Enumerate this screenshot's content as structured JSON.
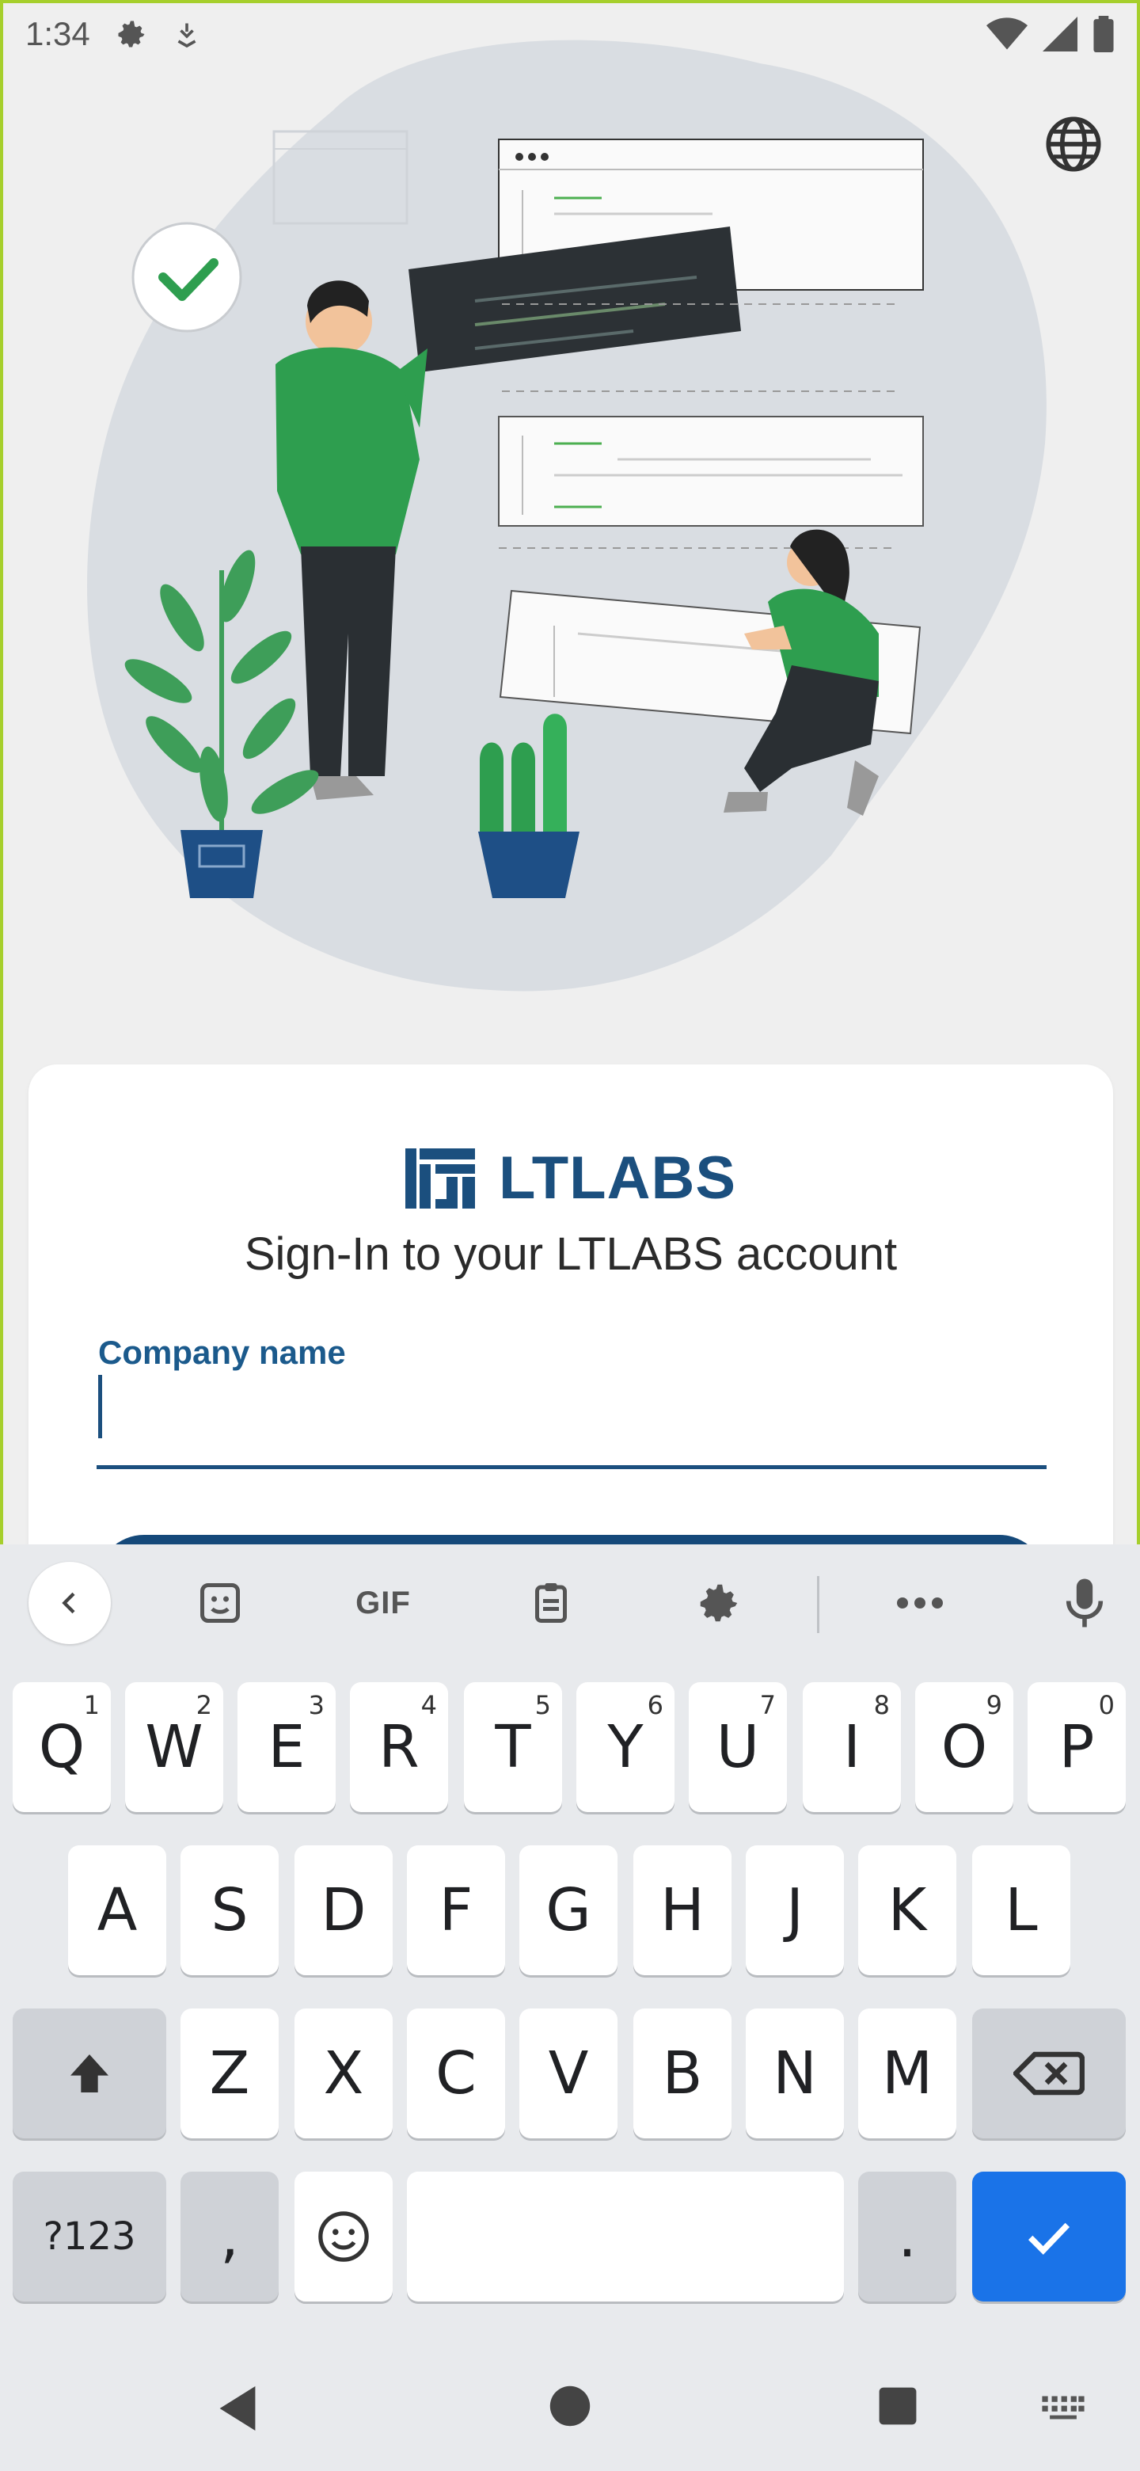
{
  "status_bar": {
    "time": "1:34",
    "icons": [
      "settings-icon",
      "download-icon",
      "wifi-icon",
      "signal-icon",
      "battery-icon"
    ]
  },
  "top_bar": {
    "language_icon": "globe-icon"
  },
  "login": {
    "brand": "LTLABS",
    "subtitle": "Sign-In to your LTLABS account",
    "company_field": {
      "label": "Company name",
      "value": ""
    }
  },
  "keyboard": {
    "toolbar": {
      "back_icon": "chevron-left-icon",
      "sticker_icon": "sticker-icon",
      "gif_label": "GIF",
      "clipboard_icon": "clipboard-icon",
      "settings_icon": "gear-icon",
      "more_icon": "more-icon",
      "mic_icon": "mic-icon"
    },
    "row1": [
      {
        "key": "Q",
        "hint": "1"
      },
      {
        "key": "W",
        "hint": "2"
      },
      {
        "key": "E",
        "hint": "3"
      },
      {
        "key": "R",
        "hint": "4"
      },
      {
        "key": "T",
        "hint": "5"
      },
      {
        "key": "Y",
        "hint": "6"
      },
      {
        "key": "U",
        "hint": "7"
      },
      {
        "key": "I",
        "hint": "8"
      },
      {
        "key": "O",
        "hint": "9"
      },
      {
        "key": "P",
        "hint": "0"
      }
    ],
    "row2": [
      "A",
      "S",
      "D",
      "F",
      "G",
      "H",
      "J",
      "K",
      "L"
    ],
    "row3": [
      "Z",
      "X",
      "C",
      "V",
      "B",
      "N",
      "M"
    ],
    "row4": {
      "symbols": "?123",
      "comma": ",",
      "period": "."
    },
    "colors": {
      "background": "#e8eaed",
      "action": "#1a73e8"
    }
  },
  "nav_bar": {
    "icons": [
      "back-icon",
      "home-icon",
      "recents-icon",
      "keyboard-switch-icon"
    ]
  },
  "colors": {
    "brand": "#1b4f7e",
    "frame": "#a6cf2c"
  }
}
